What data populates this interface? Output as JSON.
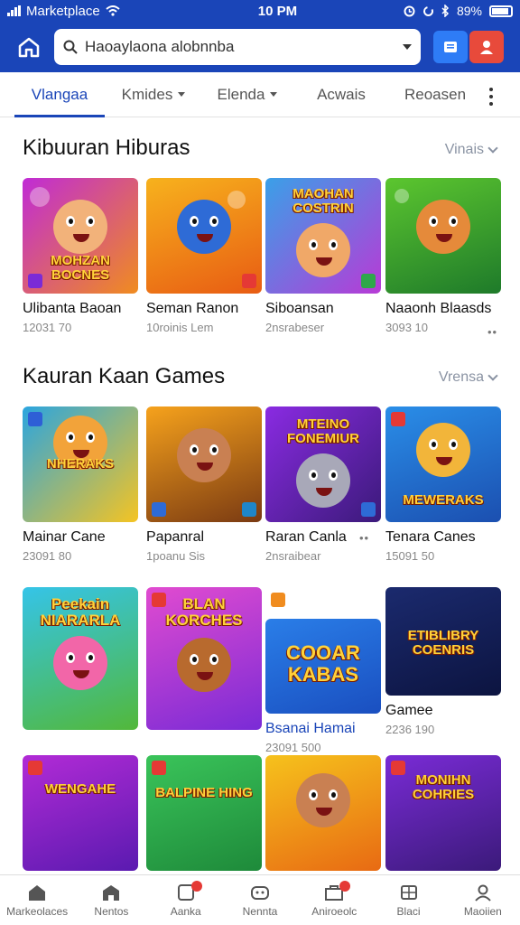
{
  "status_bar": {
    "carrier": "Marketplace",
    "time": "10 PM",
    "battery": "89%"
  },
  "search": {
    "value": "Haoaylaona alobnnba",
    "icon": "search-icon"
  },
  "tabs": [
    {
      "label": "Vlangaa",
      "active": true,
      "dropdown": false
    },
    {
      "label": "Kmides",
      "active": false,
      "dropdown": true
    },
    {
      "label": "Elenda",
      "active": false,
      "dropdown": true
    },
    {
      "label": "Acwais",
      "active": false,
      "dropdown": false
    },
    {
      "label": "Reoasen",
      "active": false,
      "dropdown": false
    }
  ],
  "sections": [
    {
      "title": "Kibuuran Hiburas",
      "view_all": "Vinais",
      "cards": [
        {
          "name": "Ulibanta Baoan",
          "sub": "12031 70",
          "banner": "MOHZAN BOCNES"
        },
        {
          "name": "Seman Ranon",
          "sub": "10roinis Lem",
          "banner": ""
        },
        {
          "name": "Siboansan",
          "sub": "2nsrabeser",
          "banner": "MAOHAN COSTRIN"
        },
        {
          "name": "Naaonh Blaasds",
          "sub": "3093 10",
          "banner": ""
        }
      ]
    },
    {
      "title": "Kauran Kaan Games",
      "view_all": "Vrensa",
      "cards": [
        {
          "name": "Mainar Cane",
          "sub": "23091 80",
          "banner": "NHERAKS"
        },
        {
          "name": "Papanral",
          "sub": "1poanu Sis",
          "banner": ""
        },
        {
          "name": "Raran Canla",
          "sub": "2nsraibear",
          "banner": "MTEINO FONEMIUR"
        },
        {
          "name": "Tenara Canes",
          "sub": "15091 50",
          "banner": "MEWERAKS"
        }
      ]
    }
  ],
  "grid_row_3": [
    {
      "name": "",
      "sub": "",
      "banner": "Peekain NIARARLA"
    },
    {
      "name": "",
      "sub": "",
      "banner": "BLAN KORCHES"
    },
    {
      "name": "Bsanai Hamai",
      "sub": "23091 500",
      "banner": "COOAR KABAS"
    },
    {
      "name": "Gamee",
      "sub": "2236 190",
      "banner": "ETIBLIBRY COENRIS"
    }
  ],
  "grid_row_4": [
    {
      "banner": "WENGAHE"
    },
    {
      "banner": "BALPINE HING"
    },
    {
      "banner": ""
    },
    {
      "banner": "MONIHN COHRIES"
    }
  ],
  "bottom_nav": [
    {
      "label": "Markeolaces",
      "icon": "home-icon",
      "badge": false
    },
    {
      "label": "Nentos",
      "icon": "store-icon",
      "badge": false
    },
    {
      "label": "Aanka",
      "icon": "notification-icon",
      "badge": true
    },
    {
      "label": "Nennta",
      "icon": "gamepad-icon",
      "badge": false
    },
    {
      "label": "Aniroeolc",
      "icon": "apps-icon",
      "badge": true
    },
    {
      "label": "Blaci",
      "icon": "grid-icon",
      "badge": false
    },
    {
      "label": "Maoiien",
      "icon": "profile-icon",
      "badge": false
    }
  ],
  "colors": {
    "primary": "#1a45b8",
    "accent_blue": "#2e7cf6",
    "accent_red": "#e84a3b"
  }
}
